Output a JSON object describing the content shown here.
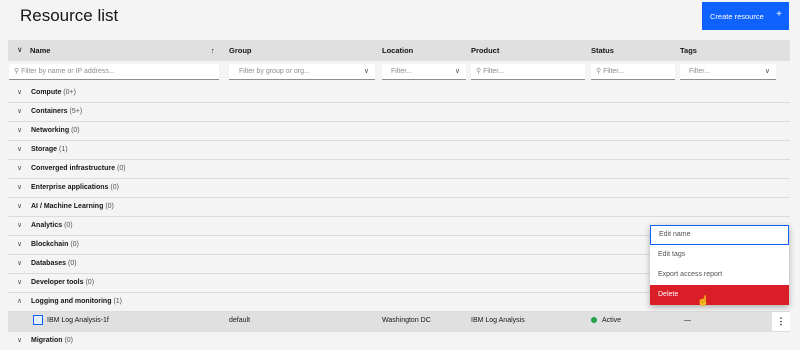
{
  "page": {
    "title": "Resource list",
    "create_button": "Create resource",
    "plus": "+"
  },
  "header": {
    "collapse_icon": "∨",
    "columns": [
      "Name",
      "Group",
      "Location",
      "Product",
      "Status",
      "Tags"
    ],
    "sort_icon": "↑"
  },
  "filters": {
    "name": "Filter by name or IP address...",
    "group": "Filter by group or org...",
    "location": "Filter...",
    "product": "Filter...",
    "status": "Filter...",
    "tags": "Filter..."
  },
  "categories": [
    {
      "name": "Compute",
      "count": "(0+)"
    },
    {
      "name": "Containers",
      "count": "(5+)"
    },
    {
      "name": "Networking",
      "count": "(0)"
    },
    {
      "name": "Storage",
      "count": "(1)"
    },
    {
      "name": "Converged infrastructure",
      "count": "(0)"
    },
    {
      "name": "Enterprise applications",
      "count": "(0)"
    },
    {
      "name": "AI / Machine Learning",
      "count": "(0)"
    },
    {
      "name": "Analytics",
      "count": "(0)"
    },
    {
      "name": "Blockchain",
      "count": "(0)"
    },
    {
      "name": "Databases",
      "count": "(0)"
    },
    {
      "name": "Developer tools",
      "count": "(0)"
    },
    {
      "name": "Logging and monitoring",
      "count": "(1)"
    }
  ],
  "resource_row": {
    "name": "IBM Log Analysis-1f",
    "group": "default",
    "location": "Washington DC",
    "product": "IBM Log Analysis",
    "status": "Active",
    "tags": "—",
    "overflow": "⋮"
  },
  "partial_row": {
    "name": "Migration",
    "count": "(0)"
  },
  "context_menu": [
    "Edit name",
    "Edit tags",
    "Export access report",
    "Delete"
  ],
  "colors": {
    "primary": "#0f62fe",
    "danger": "#da1e28",
    "active": "#24a148"
  }
}
